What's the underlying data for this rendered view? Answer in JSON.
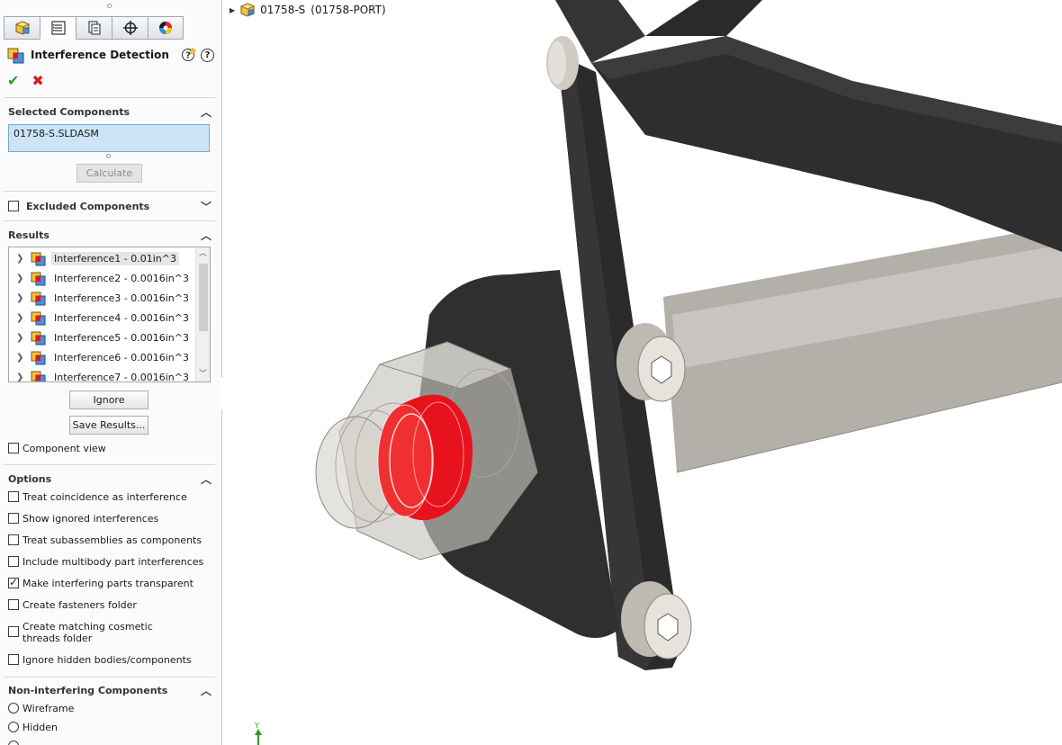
{
  "window": {
    "assembly_name": "01758-S",
    "configuration": "(01758-PORT)"
  },
  "tabs": [
    {
      "icon": "feature-manager-icon"
    },
    {
      "icon": "property-manager-icon"
    },
    {
      "icon": "configuration-manager-icon"
    },
    {
      "icon": "dimxpert-icon"
    },
    {
      "icon": "display-manager-icon"
    }
  ],
  "property_manager": {
    "title": "Interference Detection",
    "help_label": "?",
    "ok_label": "✔",
    "cancel_label": "✖"
  },
  "selected_components": {
    "header": "Selected Components",
    "value": "01758-S.SLDASM",
    "calculate_label": "Calculate"
  },
  "excluded_components": {
    "header": "Excluded Components"
  },
  "results": {
    "header": "Results",
    "items": [
      {
        "label": "Interference1 - 0.01in^3",
        "selected": true
      },
      {
        "label": "Interference2 - 0.0016in^3",
        "selected": false
      },
      {
        "label": "Interference3 - 0.0016in^3",
        "selected": false
      },
      {
        "label": "Interference4 - 0.0016in^3",
        "selected": false
      },
      {
        "label": "Interference5 - 0.0016in^3",
        "selected": false
      },
      {
        "label": "Interference6 - 0.0016in^3",
        "selected": false
      },
      {
        "label": "Interference7 - 0.0016in^3",
        "selected": false
      }
    ],
    "ignore_label": "Ignore",
    "save_label": "Save Results...",
    "component_view_label": "Component view",
    "component_view_checked": false
  },
  "options": {
    "header": "Options",
    "items": [
      {
        "label": "Treat coincidence as interference",
        "checked": false
      },
      {
        "label": "Show ignored interferences",
        "checked": false
      },
      {
        "label": "Treat subassemblies as components",
        "checked": false
      },
      {
        "label": "Include multibody part interferences",
        "checked": false
      },
      {
        "label": "Make interfering parts transparent",
        "checked": true
      },
      {
        "label": "Create fasteners folder",
        "checked": false
      },
      {
        "label": "Create matching cosmetic threads folder",
        "checked": false
      },
      {
        "label": "Ignore hidden bodies/components",
        "checked": false
      }
    ]
  },
  "non_interfering": {
    "header": "Non-interfering Components",
    "items": [
      {
        "label": "Wireframe",
        "selected": false
      },
      {
        "label": "Hidden",
        "selected": false
      }
    ]
  },
  "triad": {
    "axis_label": "Y"
  },
  "colors": {
    "interference_highlight": "#e8121c",
    "bracket_dark": "#2b2b2b",
    "selection_blue": "#cce4f7"
  }
}
